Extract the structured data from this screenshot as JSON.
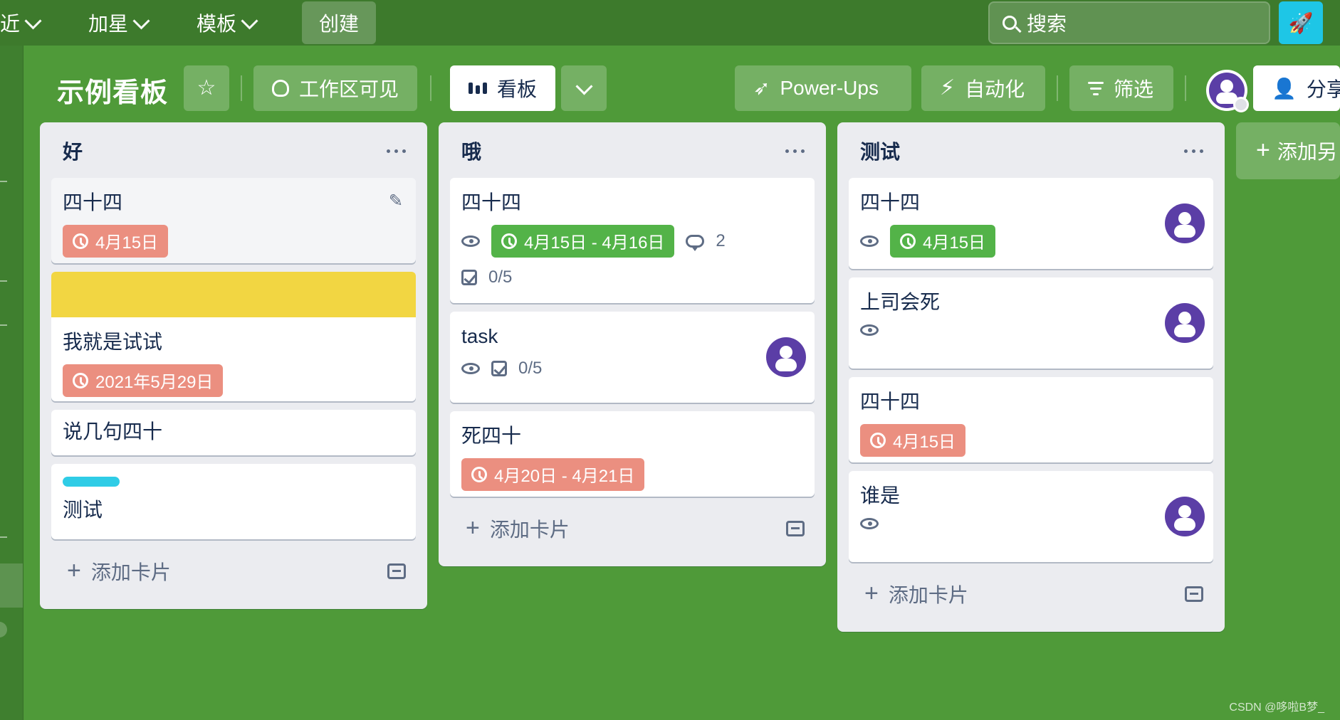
{
  "topbar": {
    "recent": "近",
    "starred": "加星",
    "templates": "模板",
    "create": "创建",
    "search_placeholder": "搜索"
  },
  "board": {
    "title": "示例看板",
    "visibility": "工作区可见",
    "view": "看板",
    "powerups": "Power-Ups",
    "automation": "自动化",
    "filter": "筛选",
    "share": "分享",
    "add_list": "添加另"
  },
  "lists": [
    {
      "title": "好",
      "cards": [
        {
          "title": "四十四",
          "due": "4月15日"
        },
        {
          "title": "我就是试试",
          "due": "2021年5月29日"
        },
        {
          "title": "说几句四十"
        },
        {
          "title": "测试"
        }
      ],
      "add_card": "添加卡片"
    },
    {
      "title": "哦",
      "cards": [
        {
          "title": "四十四",
          "due": "4月15日 - 4月16日",
          "comments": "2",
          "checklist": "0/5"
        },
        {
          "title": "task",
          "checklist": "0/5"
        },
        {
          "title": "死四十",
          "due": "4月20日 - 4月21日"
        }
      ],
      "add_card": "添加卡片"
    },
    {
      "title": "测试",
      "cards": [
        {
          "title": "四十四",
          "due": "4月15日"
        },
        {
          "title": "上司会死"
        },
        {
          "title": "四十四",
          "due": "4月15日"
        },
        {
          "title": "谁是"
        }
      ],
      "add_card": "添加卡片"
    }
  ],
  "watermark": "CSDN @哆啦B梦_",
  "colors": {
    "board_bg": "#4f9a39",
    "list_bg": "#ebecf0",
    "due_red": "#eb8f80",
    "due_green": "#53b348",
    "label_yellow": "#f2d642",
    "label_cyan": "#2fcce6",
    "avatar": "#5b3ea6"
  },
  "icons": {
    "search": "search-icon",
    "star": "star-icon",
    "visibility": "people-icon",
    "view": "board-icon",
    "powerups": "rocket-icon",
    "automation": "bolt-icon",
    "filter": "filter-icon",
    "share": "add-person-icon",
    "watch": "eye-icon",
    "comment": "comment-icon",
    "checklist": "checklist-icon",
    "template": "template-icon"
  }
}
